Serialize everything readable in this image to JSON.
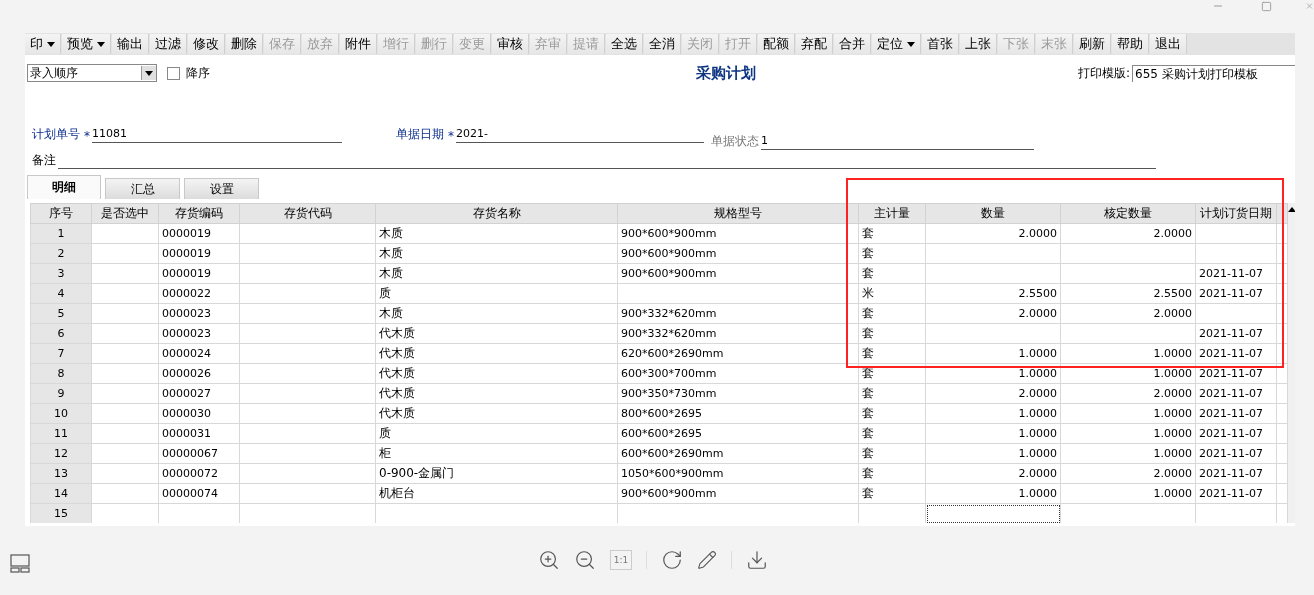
{
  "toolbar": [
    {
      "label": "印",
      "disabled": false,
      "dropdown": true
    },
    {
      "label": "预览",
      "disabled": false,
      "dropdown": true
    },
    {
      "label": "输出",
      "disabled": false,
      "dropdown": false
    },
    {
      "label": "过滤",
      "disabled": false,
      "dropdown": false
    },
    {
      "label": "修改",
      "disabled": false,
      "dropdown": false
    },
    {
      "label": "删除",
      "disabled": false,
      "dropdown": false
    },
    {
      "label": "保存",
      "disabled": true,
      "dropdown": false
    },
    {
      "label": "放弃",
      "disabled": true,
      "dropdown": false
    },
    {
      "label": "附件",
      "disabled": false,
      "dropdown": false
    },
    {
      "label": "增行",
      "disabled": true,
      "dropdown": false
    },
    {
      "label": "删行",
      "disabled": true,
      "dropdown": false
    },
    {
      "label": "变更",
      "disabled": true,
      "dropdown": false
    },
    {
      "label": "审核",
      "disabled": false,
      "dropdown": false
    },
    {
      "label": "弃审",
      "disabled": true,
      "dropdown": false
    },
    {
      "label": "提请",
      "disabled": true,
      "dropdown": false
    },
    {
      "label": "全选",
      "disabled": false,
      "dropdown": false
    },
    {
      "label": "全消",
      "disabled": false,
      "dropdown": false
    },
    {
      "label": "关闭",
      "disabled": true,
      "dropdown": false
    },
    {
      "label": "打开",
      "disabled": true,
      "dropdown": false
    },
    {
      "label": "配额",
      "disabled": false,
      "dropdown": false
    },
    {
      "label": "弃配",
      "disabled": false,
      "dropdown": false
    },
    {
      "label": "合并",
      "disabled": false,
      "dropdown": false
    },
    {
      "label": "定位",
      "disabled": false,
      "dropdown": true
    },
    {
      "label": "首张",
      "disabled": false,
      "dropdown": false
    },
    {
      "label": "上张",
      "disabled": false,
      "dropdown": false
    },
    {
      "label": "下张",
      "disabled": true,
      "dropdown": false
    },
    {
      "label": "末张",
      "disabled": true,
      "dropdown": false
    },
    {
      "label": "刷新",
      "disabled": false,
      "dropdown": false
    },
    {
      "label": "帮助",
      "disabled": false,
      "dropdown": false
    },
    {
      "label": "退出",
      "disabled": false,
      "dropdown": false
    }
  ],
  "sort": {
    "value": "录入顺序",
    "descending_label": "降序",
    "descending": false
  },
  "title": "采购计划",
  "print_template": {
    "label": "打印模版:",
    "value": "655 采购计划打印模板"
  },
  "fields": {
    "plan_no": {
      "label": "计划单号",
      "required": "*",
      "value": "11081"
    },
    "date": {
      "label": "单据日期",
      "required": "*",
      "value": "2021-"
    },
    "status": {
      "label": "单据状态",
      "value": "1"
    },
    "remark": {
      "label": "备注"
    }
  },
  "tabs": [
    {
      "label": "明细",
      "selected": true
    },
    {
      "label": "汇总",
      "selected": false
    },
    {
      "label": "设置",
      "selected": false
    }
  ],
  "table": {
    "columns": [
      "序号",
      "是否选中",
      "存货编码",
      "存货代码",
      "存货名称",
      "规格型号",
      "主计量",
      "数量",
      "核定数量",
      "计划订货日期"
    ],
    "rows": [
      {
        "no": "1",
        "code": "0000019",
        "name": "木质",
        "spec": "900*600*900mm",
        "unit": "套",
        "qty": "2.0000",
        "approved_qty": "2.0000",
        "focused": false
      },
      {
        "no": "2",
        "code": "0000019",
        "name": "木质",
        "spec": "900*600*900mm",
        "unit": "套",
        "focused": false
      },
      {
        "no": "3",
        "code": "0000019",
        "name": "木质",
        "spec": "900*600*900mm",
        "unit": "套",
        "order_date": "2021-11-07",
        "focused": false
      },
      {
        "no": "4",
        "code": "0000022",
        "name": "质",
        "unit": "米",
        "qty": "2.5500",
        "approved_qty": "2.5500",
        "order_date": "2021-11-07",
        "focused": false
      },
      {
        "no": "5",
        "code": "0000023",
        "name": "木质",
        "spec": "900*332*620mm",
        "unit": "套",
        "qty": "2.0000",
        "approved_qty": "2.0000",
        "focused": false
      },
      {
        "no": "6",
        "code": "0000023",
        "name": "代木质",
        "spec": "900*332*620mm",
        "unit": "套",
        "order_date": "2021-11-07",
        "focused": false
      },
      {
        "no": "7",
        "code": "0000024",
        "name": "代木质",
        "spec": "620*600*2690mm",
        "unit": "套",
        "qty": "1.0000",
        "approved_qty": "1.0000",
        "order_date": "2021-11-07",
        "focused": false
      },
      {
        "no": "8",
        "code": "0000026",
        "name": "代木质",
        "spec": "600*300*700mm",
        "unit": "套",
        "qty": "1.0000",
        "approved_qty": "1.0000",
        "order_date": "2021-11-07",
        "focused": false
      },
      {
        "no": "9",
        "code": "0000027",
        "name": "代木质",
        "spec": "900*350*730mm",
        "unit": "套",
        "qty": "2.0000",
        "approved_qty": "2.0000",
        "order_date": "2021-11-07",
        "focused": false
      },
      {
        "no": "10",
        "code": "0000030",
        "name": "代木质",
        "spec": "800*600*2695",
        "unit": "套",
        "qty": "1.0000",
        "approved_qty": "1.0000",
        "order_date": "2021-11-07",
        "focused": false
      },
      {
        "no": "11",
        "code": "0000031",
        "name": "质",
        "spec": "600*600*2695",
        "unit": "套",
        "qty": "1.0000",
        "approved_qty": "1.0000",
        "order_date": "2021-11-07",
        "focused": false
      },
      {
        "no": "12",
        "code": "00000067",
        "name": "柜",
        "spec": "600*600*2690mm",
        "unit": "套",
        "qty": "1.0000",
        "approved_qty": "1.0000",
        "order_date": "2021-11-07",
        "focused": false
      },
      {
        "no": "13",
        "code": "00000072",
        "name": "0-900-金属门",
        "spec": "1050*600*900mm",
        "unit": "套",
        "qty": "2.0000",
        "approved_qty": "2.0000",
        "order_date": "2021-11-07",
        "focused": false
      },
      {
        "no": "14",
        "code": "00000074",
        "name": "机柜台",
        "spec": "900*600*900mm",
        "unit": "套",
        "qty": "1.0000",
        "approved_qty": "1.0000",
        "order_date": "2021-11-07",
        "focused": false
      },
      {
        "no": "15",
        "focused": true
      }
    ]
  },
  "viewer": {
    "actual_size": "1:1"
  }
}
